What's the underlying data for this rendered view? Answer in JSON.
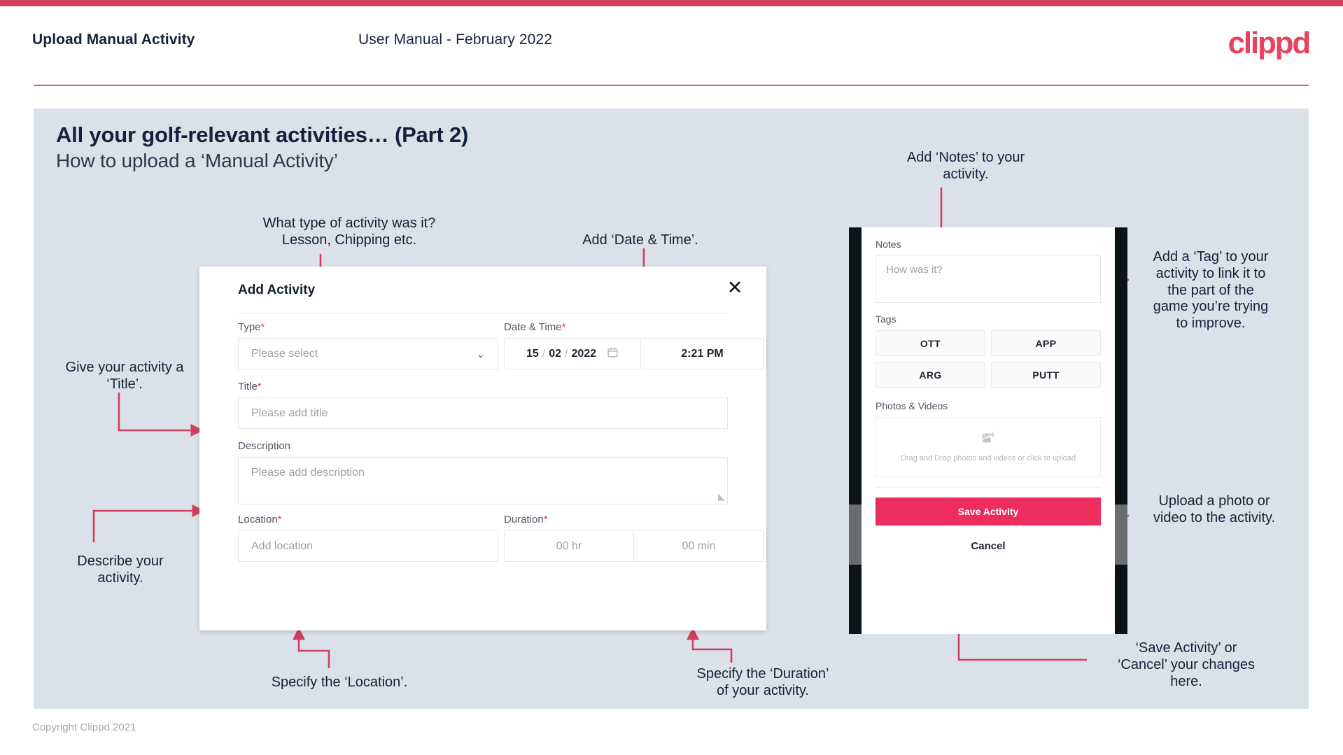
{
  "header": {
    "title": "Upload Manual Activity",
    "subtitle": "User Manual - February 2022",
    "logo": "clippd"
  },
  "slide": {
    "title": "All your golf-relevant activities… (Part 2)",
    "subtitle": "How to upload a ‘Manual Activity’"
  },
  "callouts": {
    "type": "What type of activity was it?\nLesson, Chipping etc.",
    "datetime": "Add ‘Date & Time’.",
    "title_field": "Give your activity a\n‘Title’.",
    "description": "Describe your\nactivity.",
    "location": "Specify the ‘Location’.",
    "duration": "Specify the ‘Duration’\nof your activity.",
    "notes": "Add ‘Notes’ to your\nactivity.",
    "tags": "Add a ‘Tag’ to your\nactivity to link it to\nthe part of the\ngame you’re trying\nto improve.",
    "upload": "Upload a photo or\nvideo to the activity.",
    "save_cancel": "‘Save Activity’ or\n‘Cancel’ your changes\nhere."
  },
  "dialog": {
    "title": "Add Activity",
    "close_icon": "close-icon",
    "fields": {
      "type": {
        "label": "Type",
        "required": "*",
        "placeholder": "Please select",
        "chevron": "chevron-down-icon"
      },
      "datetime": {
        "label": "Date & Time",
        "required": "*",
        "day": "15",
        "month": "02",
        "year": "2022",
        "sep": "/",
        "calendar_icon": "calendar-icon",
        "time": "2:21 PM"
      },
      "title": {
        "label": "Title",
        "required": "*",
        "placeholder": "Please add title"
      },
      "description": {
        "label": "Description",
        "required": "",
        "placeholder": "Please add description"
      },
      "location": {
        "label": "Location",
        "required": "*",
        "placeholder": "Add location"
      },
      "duration": {
        "label": "Duration",
        "required": "*",
        "hours": "00 hr",
        "minutes": "00 min"
      }
    }
  },
  "phone": {
    "notes_label": "Notes",
    "notes_placeholder": "How was it?",
    "tags_label": "Tags",
    "tags": [
      "OTT",
      "APP",
      "ARG",
      "PUTT"
    ],
    "photos_label": "Photos & Videos",
    "dropzone_text": "Drag and Drop photos and videos or\nclick to upload",
    "dropzone_icon": "add-image-icon",
    "save_label": "Save Activity",
    "cancel_label": "Cancel"
  },
  "footer": {
    "copyright": "Copyright Clippd 2021"
  },
  "colors": {
    "brand_pink": "#e8425e",
    "accent_crimson": "#cf4060",
    "save_button": "#ec2d5d",
    "slide_bg": "#dbe1e8",
    "ink": "#14213d",
    "required_red": "#f04134"
  }
}
